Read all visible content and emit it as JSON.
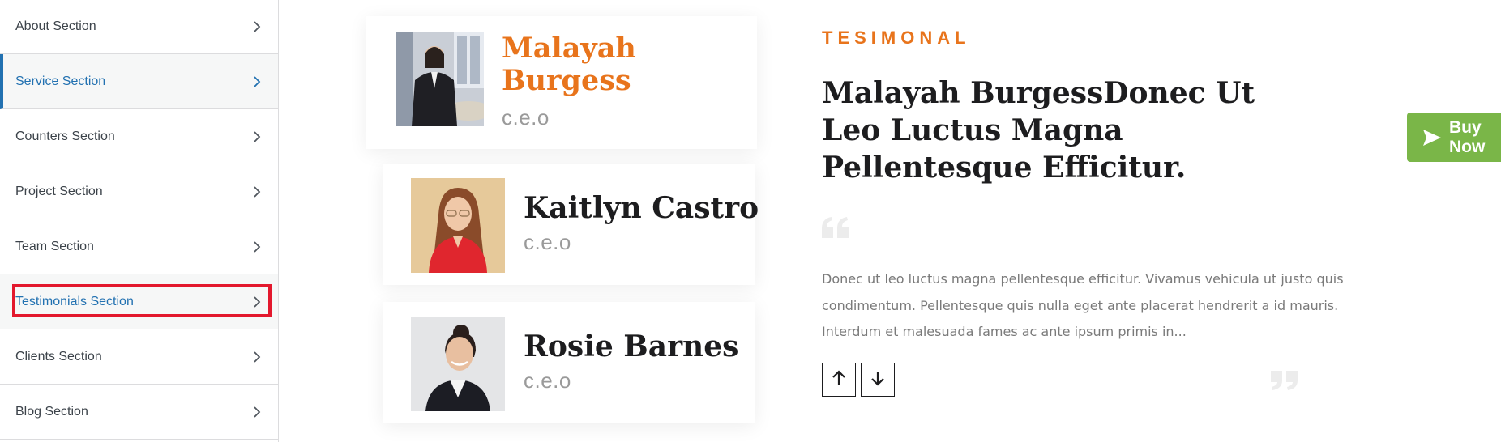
{
  "sidebar": {
    "items": [
      {
        "label": "About Section"
      },
      {
        "label": "Service Section"
      },
      {
        "label": "Counters Section"
      },
      {
        "label": "Project Section"
      },
      {
        "label": "Team Section"
      },
      {
        "label": "Testimonials Section"
      },
      {
        "label": "Clients Section"
      },
      {
        "label": "Blog Section"
      }
    ]
  },
  "testimonials": [
    {
      "name": "Malayah Burgess",
      "role": "c.e.o"
    },
    {
      "name": "Kaitlyn Castro",
      "role": "c.e.o"
    },
    {
      "name": "Rosie Barnes",
      "role": "c.e.o"
    }
  ],
  "content": {
    "eyebrow": "TESIMONAL",
    "headline": "Malayah BurgessDonec Ut Leo Luctus Magna Pellentesque Efficitur.",
    "body": "Donec ut leo luctus magna pellentesque efficitur. Vivamus vehicula ut justo quis condimentum. Pellentesque quis nulla eget ante placerat hendrerit a id mauris. Interdum et malesuada fames ac ante ipsum primis in..."
  },
  "buy_button": {
    "label": "Buy Now"
  },
  "colors": {
    "accent": "#e8741c",
    "link_active": "#2271b1",
    "highlight_border": "#e3182d",
    "buy_green": "#7ab648"
  }
}
